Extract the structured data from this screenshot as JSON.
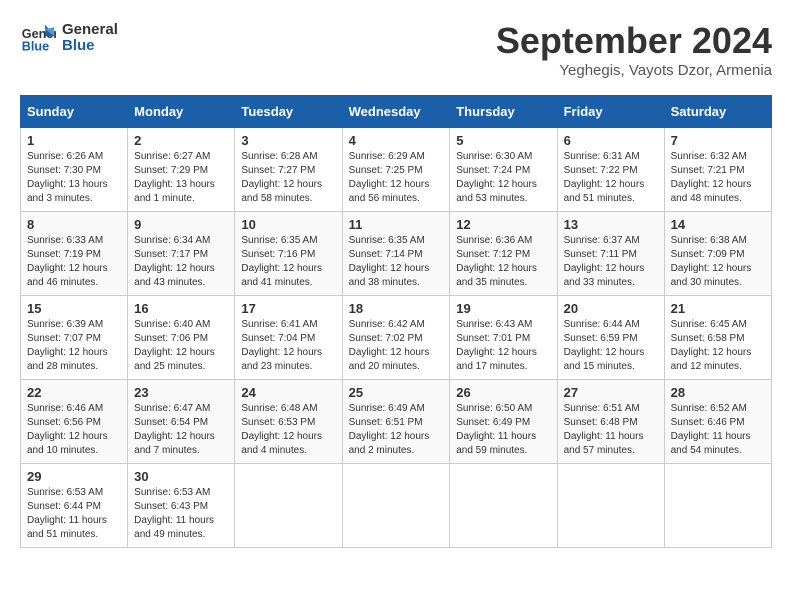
{
  "header": {
    "logo_line1": "General",
    "logo_line2": "Blue",
    "month": "September 2024",
    "location": "Yeghegis, Vayots Dzor, Armenia"
  },
  "weekdays": [
    "Sunday",
    "Monday",
    "Tuesday",
    "Wednesday",
    "Thursday",
    "Friday",
    "Saturday"
  ],
  "weeks": [
    [
      {
        "day": "1",
        "info": "Sunrise: 6:26 AM\nSunset: 7:30 PM\nDaylight: 13 hours\nand 3 minutes."
      },
      {
        "day": "2",
        "info": "Sunrise: 6:27 AM\nSunset: 7:29 PM\nDaylight: 13 hours\nand 1 minute."
      },
      {
        "day": "3",
        "info": "Sunrise: 6:28 AM\nSunset: 7:27 PM\nDaylight: 12 hours\nand 58 minutes."
      },
      {
        "day": "4",
        "info": "Sunrise: 6:29 AM\nSunset: 7:25 PM\nDaylight: 12 hours\nand 56 minutes."
      },
      {
        "day": "5",
        "info": "Sunrise: 6:30 AM\nSunset: 7:24 PM\nDaylight: 12 hours\nand 53 minutes."
      },
      {
        "day": "6",
        "info": "Sunrise: 6:31 AM\nSunset: 7:22 PM\nDaylight: 12 hours\nand 51 minutes."
      },
      {
        "day": "7",
        "info": "Sunrise: 6:32 AM\nSunset: 7:21 PM\nDaylight: 12 hours\nand 48 minutes."
      }
    ],
    [
      {
        "day": "8",
        "info": "Sunrise: 6:33 AM\nSunset: 7:19 PM\nDaylight: 12 hours\nand 46 minutes."
      },
      {
        "day": "9",
        "info": "Sunrise: 6:34 AM\nSunset: 7:17 PM\nDaylight: 12 hours\nand 43 minutes."
      },
      {
        "day": "10",
        "info": "Sunrise: 6:35 AM\nSunset: 7:16 PM\nDaylight: 12 hours\nand 41 minutes."
      },
      {
        "day": "11",
        "info": "Sunrise: 6:35 AM\nSunset: 7:14 PM\nDaylight: 12 hours\nand 38 minutes."
      },
      {
        "day": "12",
        "info": "Sunrise: 6:36 AM\nSunset: 7:12 PM\nDaylight: 12 hours\nand 35 minutes."
      },
      {
        "day": "13",
        "info": "Sunrise: 6:37 AM\nSunset: 7:11 PM\nDaylight: 12 hours\nand 33 minutes."
      },
      {
        "day": "14",
        "info": "Sunrise: 6:38 AM\nSunset: 7:09 PM\nDaylight: 12 hours\nand 30 minutes."
      }
    ],
    [
      {
        "day": "15",
        "info": "Sunrise: 6:39 AM\nSunset: 7:07 PM\nDaylight: 12 hours\nand 28 minutes."
      },
      {
        "day": "16",
        "info": "Sunrise: 6:40 AM\nSunset: 7:06 PM\nDaylight: 12 hours\nand 25 minutes."
      },
      {
        "day": "17",
        "info": "Sunrise: 6:41 AM\nSunset: 7:04 PM\nDaylight: 12 hours\nand 23 minutes."
      },
      {
        "day": "18",
        "info": "Sunrise: 6:42 AM\nSunset: 7:02 PM\nDaylight: 12 hours\nand 20 minutes."
      },
      {
        "day": "19",
        "info": "Sunrise: 6:43 AM\nSunset: 7:01 PM\nDaylight: 12 hours\nand 17 minutes."
      },
      {
        "day": "20",
        "info": "Sunrise: 6:44 AM\nSunset: 6:59 PM\nDaylight: 12 hours\nand 15 minutes."
      },
      {
        "day": "21",
        "info": "Sunrise: 6:45 AM\nSunset: 6:58 PM\nDaylight: 12 hours\nand 12 minutes."
      }
    ],
    [
      {
        "day": "22",
        "info": "Sunrise: 6:46 AM\nSunset: 6:56 PM\nDaylight: 12 hours\nand 10 minutes."
      },
      {
        "day": "23",
        "info": "Sunrise: 6:47 AM\nSunset: 6:54 PM\nDaylight: 12 hours\nand 7 minutes."
      },
      {
        "day": "24",
        "info": "Sunrise: 6:48 AM\nSunset: 6:53 PM\nDaylight: 12 hours\nand 4 minutes."
      },
      {
        "day": "25",
        "info": "Sunrise: 6:49 AM\nSunset: 6:51 PM\nDaylight: 12 hours\nand 2 minutes."
      },
      {
        "day": "26",
        "info": "Sunrise: 6:50 AM\nSunset: 6:49 PM\nDaylight: 11 hours\nand 59 minutes."
      },
      {
        "day": "27",
        "info": "Sunrise: 6:51 AM\nSunset: 6:48 PM\nDaylight: 11 hours\nand 57 minutes."
      },
      {
        "day": "28",
        "info": "Sunrise: 6:52 AM\nSunset: 6:46 PM\nDaylight: 11 hours\nand 54 minutes."
      }
    ],
    [
      {
        "day": "29",
        "info": "Sunrise: 6:53 AM\nSunset: 6:44 PM\nDaylight: 11 hours\nand 51 minutes."
      },
      {
        "day": "30",
        "info": "Sunrise: 6:53 AM\nSunset: 6:43 PM\nDaylight: 11 hours\nand 49 minutes."
      },
      null,
      null,
      null,
      null,
      null
    ]
  ]
}
